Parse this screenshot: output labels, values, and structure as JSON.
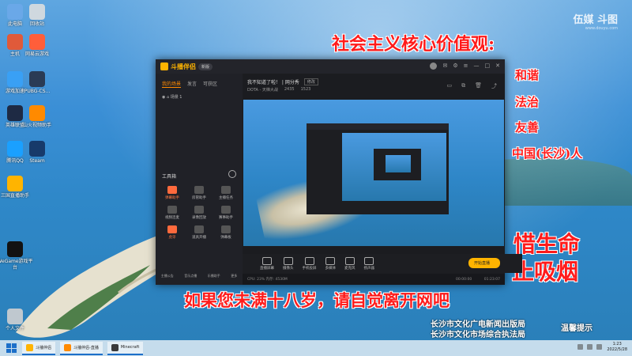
{
  "desktop": {
    "icons": [
      {
        "label": "此电脑",
        "color": "#6aa8e8"
      },
      {
        "label": "回收站",
        "color": "#cfd8df"
      },
      {
        "label": "主机",
        "color": "#e05a3a"
      },
      {
        "label": "网易云游戏",
        "color": "#ff5e3a"
      },
      {
        "label": "游戏加速",
        "color": "#39a0f5"
      },
      {
        "label": "PUBG-CS...",
        "color": "#2a3b55"
      },
      {
        "label": "英雄联盟",
        "color": "#1e2a44"
      },
      {
        "label": "山火视频助手",
        "color": "#ff8a00"
      },
      {
        "label": "腾讯QQ",
        "color": "#1aa0ff"
      },
      {
        "label": "Steam",
        "color": "#173a6a"
      },
      {
        "label": "三国直播助手",
        "color": "#ffb400"
      },
      {
        "label": "WeGame游戏平台",
        "color": "#121212"
      },
      {
        "label": "个人文件",
        "color": "#bfc8cf"
      }
    ]
  },
  "watermark": {
    "title": "伍媒 斗图",
    "sub": "www.douyu.com"
  },
  "overlay": {
    "heading": "社会主义核心价值观:",
    "values": [
      "和谐",
      "法治",
      "友善"
    ],
    "city": "中国(长沙)人",
    "cherish": "惜生命",
    "nosmoke": "止吸烟",
    "notice": "如果您未满十八岁，请自觉离开网吧",
    "issuer1": "长沙市文化广电新闻出版局",
    "issuer2": "长沙市文化市场综合执法局",
    "tip": "温馨提示"
  },
  "app": {
    "logo": "斗播伴侣",
    "logo_pill": "新版",
    "tabs": [
      "我的场景",
      "发言",
      "可获区"
    ],
    "scene": "场景 1",
    "room_title": "我不知道了啦！ | 网分秀",
    "room_tag": "修改",
    "room_category": "DOTA - 天梯大战",
    "room_number": "2435",
    "room_online": "1523",
    "tools_title": "工具箱",
    "tools": [
      {
        "label": "弹幕助手",
        "hot": true
      },
      {
        "label": "房管助手",
        "hot": false
      },
      {
        "label": "主播任务",
        "hot": false
      },
      {
        "label": "视频连麦",
        "hot": false
      },
      {
        "label": "录像回放",
        "hot": false
      },
      {
        "label": "赛事助手",
        "hot": false
      },
      {
        "label": "虎牙",
        "hot": true
      },
      {
        "label": "道具开播",
        "hot": false
      },
      {
        "label": "弹幕板",
        "hot": false
      }
    ],
    "left_bottom": [
      "主播公告",
      "音乐点播",
      "乐播助手",
      "更多"
    ],
    "bottom_tools": [
      "直播屏幕",
      "摄像头",
      "手机投屏",
      "多媒体",
      "麦克风",
      "扬声器"
    ],
    "start_label": "开始直播",
    "status_left": "CPU: 23%  内存: 4530M",
    "status_mid": "00:00:00",
    "status_right": "01:23:07"
  },
  "taskbar": {
    "tasks": [
      {
        "label": "斗播伴侣",
        "color": "#ffb400",
        "active": true
      },
      {
        "label": "斗播伴侣-直播",
        "color": "#ff8a00",
        "active": true
      },
      {
        "label": "Minecraft",
        "color": "#3a3a3a",
        "active": true
      }
    ],
    "time": "1:23",
    "date": "2022/5/28"
  }
}
